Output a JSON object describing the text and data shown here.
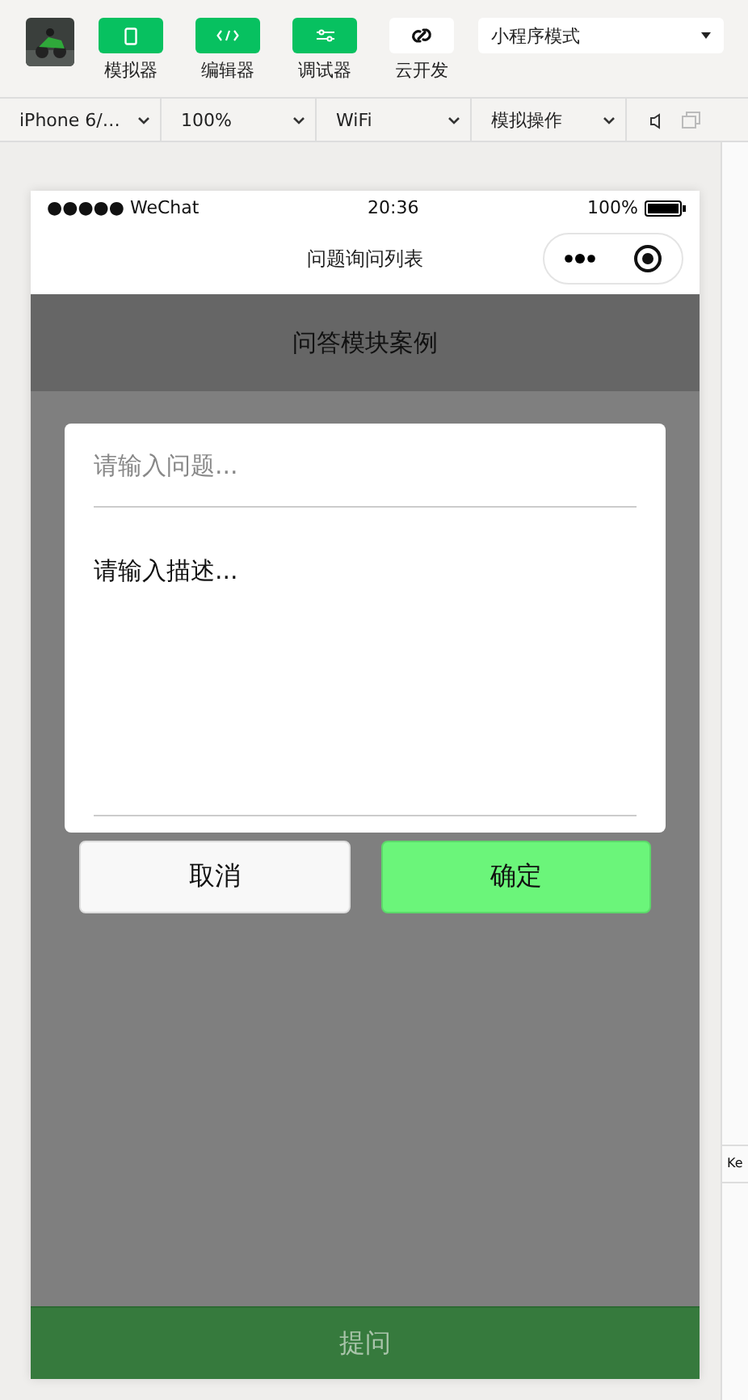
{
  "toolbar": {
    "tools": [
      {
        "label": "模拟器",
        "kind": "phone",
        "selected": true
      },
      {
        "label": "编辑器",
        "kind": "code",
        "selected": true
      },
      {
        "label": "调试器",
        "kind": "sliders",
        "selected": true
      },
      {
        "label": "云开发",
        "kind": "cloud",
        "selected": false
      }
    ],
    "mode": "小程序模式"
  },
  "device_bar": {
    "selects": [
      "iPhone 6/…",
      "100%",
      "WiFi",
      "模拟操作"
    ]
  },
  "phone": {
    "status_bar": {
      "carrier": "●●●●● WeChat",
      "time": "20:36",
      "battery": "100%"
    },
    "nav_title": "问题询问列表",
    "header": "问答模块案例",
    "dialog": {
      "question_placeholder": "请输入问题...",
      "description_placeholder": "请输入描述...",
      "buttons": [
        {
          "label": "取消",
          "kind": "cancel"
        },
        {
          "label": "确定",
          "kind": "confirm"
        }
      ]
    },
    "bottom_button": {
      "label": "提问",
      "disabled": true
    }
  },
  "side_panel": {
    "text": "Ke"
  }
}
